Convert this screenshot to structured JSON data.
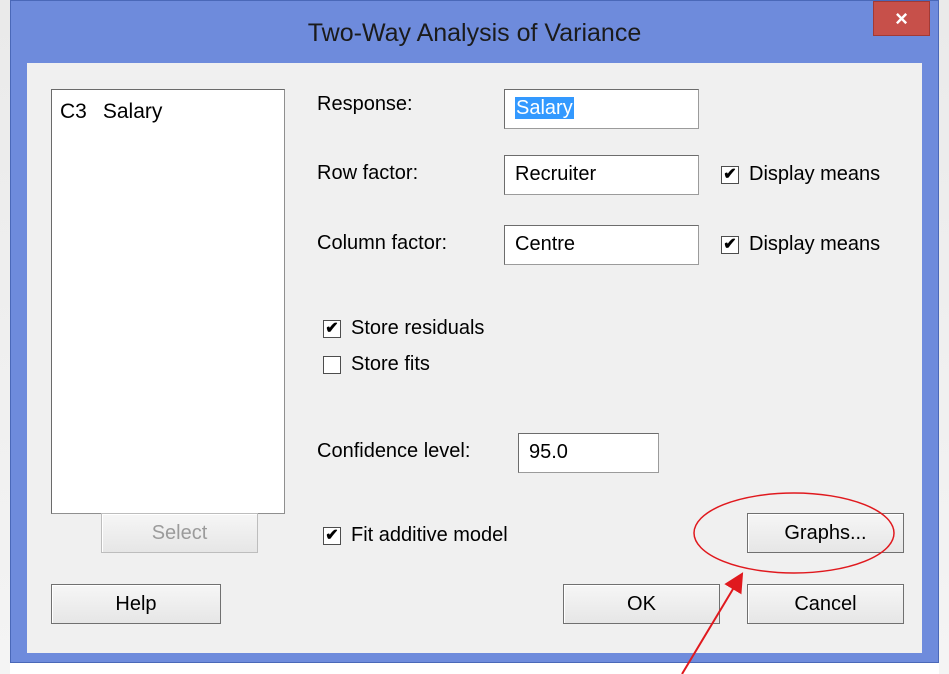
{
  "dialog": {
    "title": "Two-Way Analysis of Variance",
    "close_label": "×"
  },
  "variables_list": {
    "items": [
      {
        "column": "C3",
        "name": "Salary"
      }
    ]
  },
  "fields": {
    "response": {
      "label": "Response:",
      "value": "Salary"
    },
    "row_factor": {
      "label": "Row factor:",
      "value": "Recruiter",
      "display_means_label": "Display means",
      "display_means_checked": true
    },
    "column_factor": {
      "label": "Column factor:",
      "value": "Centre",
      "display_means_label": "Display means",
      "display_means_checked": true
    },
    "confidence": {
      "label": "Confidence level:",
      "value": "95.0"
    }
  },
  "options": {
    "store_residuals": {
      "label": "Store residuals",
      "checked": true
    },
    "store_fits": {
      "label": "Store fits",
      "checked": false
    },
    "fit_additive": {
      "label": "Fit additive model",
      "checked": true
    }
  },
  "buttons": {
    "select": "Select",
    "graphs": "Graphs...",
    "help": "Help",
    "ok": "OK",
    "cancel": "Cancel"
  },
  "colors": {
    "frame": "#6e8bdc",
    "close": "#c7504a",
    "annotation": "#e0191e"
  },
  "check_mark": "✔"
}
